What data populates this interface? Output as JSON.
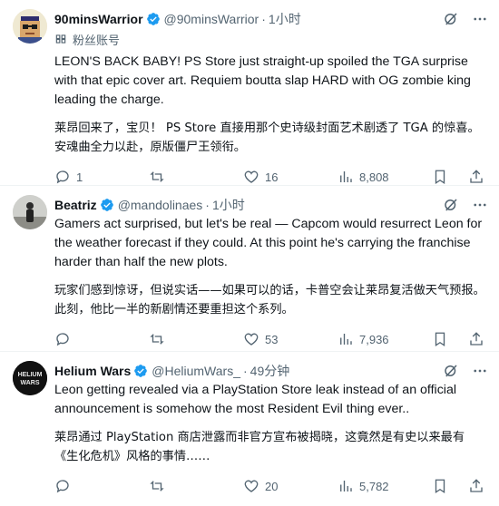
{
  "tweets": [
    {
      "name": "90minsWarrior",
      "handle": "@90minsWarrior",
      "dot": "·",
      "time": "1小时",
      "fan_label": "粉丝账号",
      "text": "LEON'S BACK BABY!  PS Store just straight-up spoiled the TGA surprise with that epic cover art. Requiem boutta slap HARD with OG zombie king leading the charge.",
      "translation": "莱昂回来了，宝贝！ PS Store 直接用那个史诗级封面艺术剧透了 TGA 的惊喜。安魂曲全力以赴，原版僵尸王领衔。",
      "replies": "1",
      "reposts": "",
      "likes": "16",
      "views": "8,808"
    },
    {
      "name": "Beatriz",
      "handle": "@mandolinaes",
      "dot": "·",
      "time": "1小时",
      "text": "Gamers act surprised, but let's be real — Capcom would resurrect Leon for the weather forecast if they could. At this point he's carrying the franchise harder than half the new plots.",
      "translation": "玩家们感到惊讶，但说实话——如果可以的话，卡普空会让莱昂复活做天气预报。此刻，他比一半的新剧情还要重担这个系列。",
      "replies": "",
      "reposts": "",
      "likes": "53",
      "views": "7,936"
    },
    {
      "name": "Helium Wars",
      "handle": "@HeliumWars_",
      "dot": "·",
      "time": "49分钟",
      "avatar_text": "HELIUM WARS",
      "text": "Leon getting revealed via a PlayStation Store leak instead of an official announcement is somehow the most Resident Evil thing ever..",
      "translation": "莱昂通过 PlayStation 商店泄露而非官方宣布被揭晓，这竟然是有史以来最有《生化危机》风格的事情……",
      "replies": "",
      "reposts": "",
      "likes": "20",
      "views": "5,782"
    }
  ],
  "colors": {
    "verified": "#1d9bf0",
    "secondary": "#536471",
    "divider": "#eff3f4"
  }
}
